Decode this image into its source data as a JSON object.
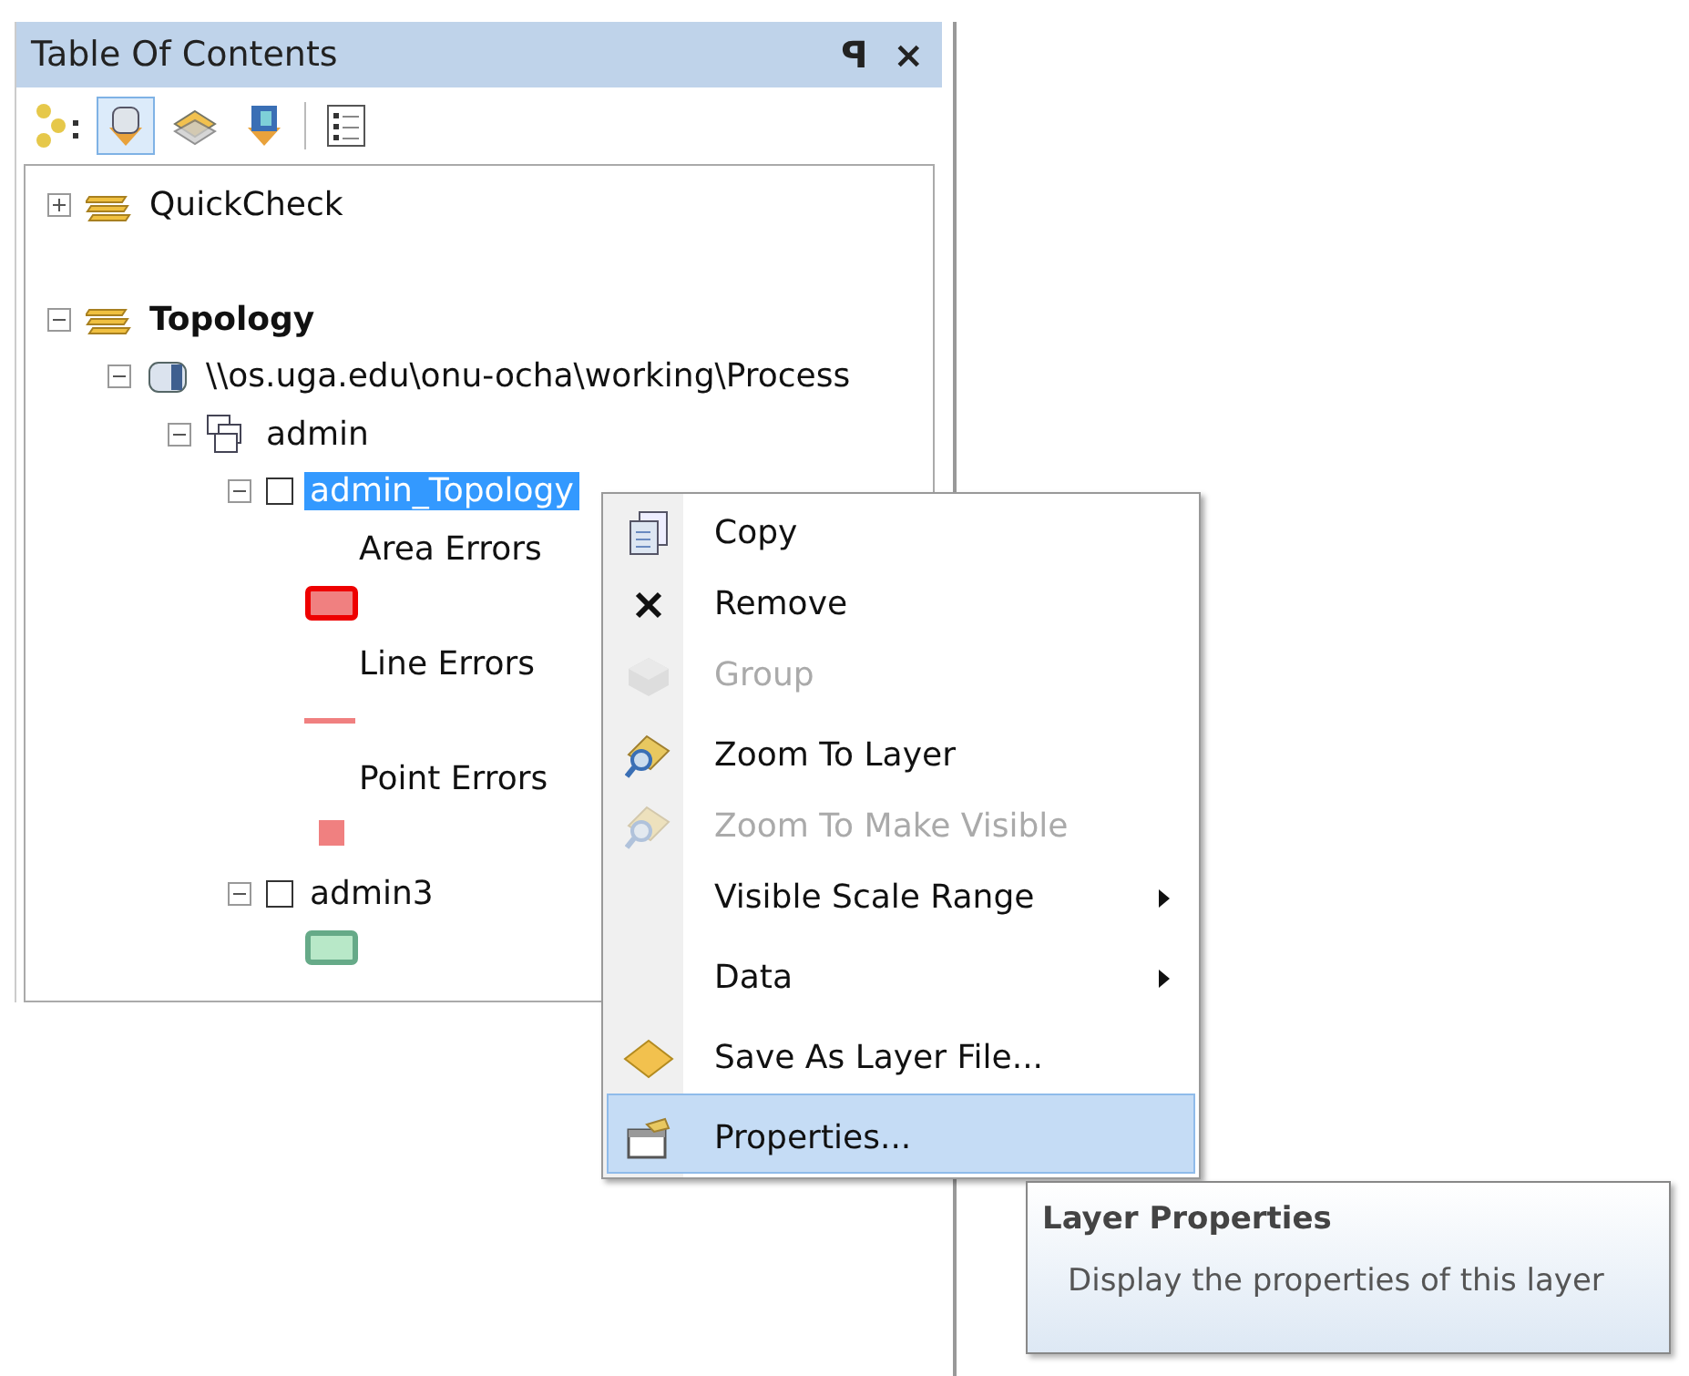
{
  "panel": {
    "title": "Table Of Contents",
    "pin": "ꟼ",
    "close": "×"
  },
  "toolbar": [
    {
      "kind": "drawing-order",
      "selected": false
    },
    {
      "kind": "source",
      "selected": true
    },
    {
      "kind": "visibility",
      "selected": false
    },
    {
      "kind": "selection",
      "selected": false
    },
    {
      "kind": "options",
      "selected": false
    }
  ],
  "tree": [
    {
      "kind": "group",
      "label": "QuickCheck",
      "active": false,
      "expanded": false
    },
    {
      "kind": "group",
      "label": "Topology",
      "active": true,
      "expanded": true,
      "children": [
        {
          "kind": "database",
          "label": "\\\\os.uga.edu\\onu-ocha\\working\\Process",
          "expanded": true,
          "children": [
            {
              "kind": "dataset",
              "label": "admin",
              "expanded": true,
              "children": [
                {
                  "kind": "layer",
                  "label": "admin_Topology",
                  "expanded": true,
                  "checked": false,
                  "selected": true,
                  "legend": [
                    {
                      "kind": "area",
                      "label": "Area Errors",
                      "color": "#f08080"
                    },
                    {
                      "kind": "line",
                      "label": "Line Errors",
                      "color": "#f08080"
                    },
                    {
                      "kind": "point",
                      "label": "Point Errors",
                      "color": "#f08080"
                    }
                  ]
                },
                {
                  "kind": "layer",
                  "label": "admin3",
                  "expanded": true,
                  "checked": false,
                  "selected": false,
                  "legend": [
                    {
                      "kind": "area",
                      "color": "#b8e8c8"
                    }
                  ]
                }
              ]
            }
          ]
        }
      ]
    }
  ],
  "context_menu": [
    {
      "kind": "copy",
      "label": "Copy",
      "disabled": false,
      "submenu": false,
      "separator_before": false,
      "selected": false
    },
    {
      "kind": "remove",
      "label": "Remove",
      "disabled": false,
      "submenu": false,
      "separator_before": false,
      "selected": false
    },
    {
      "kind": "group",
      "label": "Group",
      "disabled": true,
      "submenu": false,
      "separator_before": false,
      "selected": false
    },
    {
      "kind": "zoom",
      "label": "Zoom To Layer",
      "disabled": false,
      "submenu": false,
      "separator_before": true,
      "selected": false
    },
    {
      "kind": "zoom",
      "label": "Zoom To Make Visible",
      "disabled": true,
      "submenu": false,
      "separator_before": false,
      "selected": false
    },
    {
      "kind": "plain",
      "label": "Visible Scale Range",
      "disabled": false,
      "submenu": true,
      "separator_before": false,
      "selected": false
    },
    {
      "kind": "plain",
      "label": "Data",
      "disabled": false,
      "submenu": true,
      "separator_before": true,
      "selected": false
    },
    {
      "kind": "save",
      "label": "Save As Layer File...",
      "disabled": false,
      "submenu": false,
      "separator_before": true,
      "selected": false
    },
    {
      "kind": "properties",
      "label": "Properties...",
      "disabled": false,
      "submenu": false,
      "separator_before": true,
      "selected": true
    }
  ],
  "tooltip": {
    "title": "Layer Properties",
    "text": "Display the properties of this layer"
  }
}
